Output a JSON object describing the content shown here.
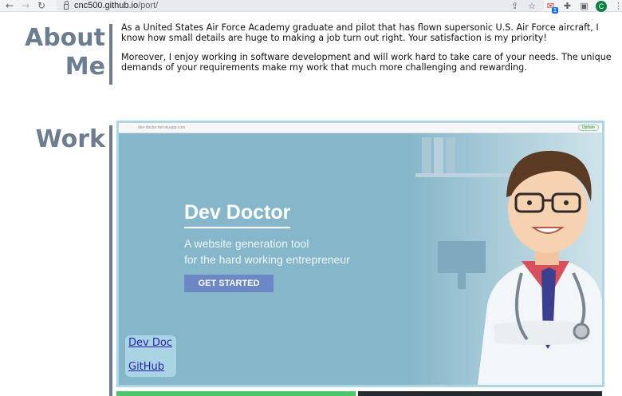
{
  "browser": {
    "url_host": "cnc500.github.io",
    "url_path": "/port/",
    "back_icon": "←",
    "forward_icon": "→",
    "reload_icon": "↻",
    "share_icon": "⇪",
    "star_icon": "☆",
    "extension_badge": "1",
    "puzzle_icon": "✚",
    "sidepanel_icon": "▣",
    "profile_initial": "C",
    "menu_icon": "⋮"
  },
  "about": {
    "heading_line1": "About",
    "heading_line2": "Me",
    "paragraph1": "As a United States Air Force Academy graduate and pilot that has flown supersonic U.S. Air Force aircraft, I know how small details are huge to making a job turn out right. Your satisfaction is my priority!",
    "paragraph2": "Moreover, I enjoy working in software development and will work hard to take care of your needs. The unique demands of your requirements make my work that much more challenging and rewarding."
  },
  "work": {
    "heading": "Work",
    "project": {
      "screenshot_url": "dev-doctor.herokuapp.com",
      "screenshot_update_label": "Update",
      "title": "Dev Doctor",
      "subtitle_line1": "A website generation tool",
      "subtitle_line2": "for the hard working entrepreneur",
      "cta_label": "GET STARTED",
      "link_demo": "Dev Doc",
      "link_github": "GitHub"
    }
  },
  "colors": {
    "heading": "#6b7d8e",
    "card_bg": "#86b6c9",
    "link": "#2b1fb0",
    "cta": "#6b88c4"
  }
}
